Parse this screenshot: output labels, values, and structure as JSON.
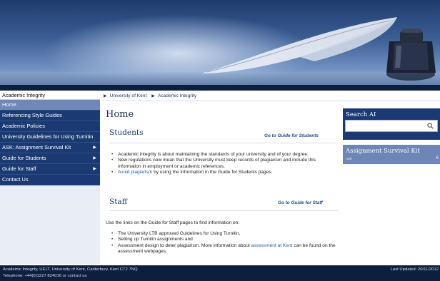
{
  "nav": {
    "title": "Academic Integrity",
    "items": [
      {
        "label": "Home",
        "arrow": ""
      },
      {
        "label": "Referencing Style Guides",
        "arrow": ""
      },
      {
        "label": "Academic Policies",
        "arrow": ""
      },
      {
        "label": "University Guidelines for Using Turnitin",
        "arrow": ""
      },
      {
        "label": "ASK: Assignment Survival Kit",
        "arrow": "▶"
      },
      {
        "label": "Guide for Students",
        "arrow": "▶"
      },
      {
        "label": "Guide for Staff",
        "arrow": "▶"
      },
      {
        "label": "Contact Us",
        "arrow": ""
      }
    ]
  },
  "breadcrumb": {
    "items": [
      "University of Kent",
      "Academic Integrity"
    ],
    "separator": "▶"
  },
  "main": {
    "title": "Home",
    "students": {
      "heading": "Students",
      "guide_link": "Go to Guide for Students",
      "bullet1": "Academic integrity is about maintaining the standards of your university and of your degree.",
      "bullet2": "New regulations now mean that the University must keep records of plagiarism and include this information in employment or academic references.",
      "bullet3_link": "Avoid plagiarism",
      "bullet3_text": " by using the information in the Guide for Students pages."
    },
    "staff": {
      "heading": "Staff",
      "guide_link": "Go to Guide for Staff",
      "intro": "Use the links on the Guide for Staff pages to find information on:",
      "bullet1": "The University LTB approved Guidelines for Using Turnitin,",
      "bullet2": "Setting up Turnitin assignments and",
      "bullet3_text": "Assessment design to deter plagiarism. More information about ",
      "bullet3_link": "assessment at Kent",
      "bullet3_tail": " can be found on the assessment webpages."
    }
  },
  "search": {
    "title": "Search AI",
    "value": "",
    "icon": "search-icon"
  },
  "survival_kit": {
    "title": "Assignment Survival Kit",
    "sub": "ASK",
    "badge": "6"
  },
  "footer": {
    "line1": "Academic Integrity, UELT, University of Kent, Canterbury, Kent CT2 7NQ",
    "line2_prefix": "Telephone: +44(0)1227 824016 or ",
    "line2_link": "contact us",
    "updated": "Last Updated: 20/11/2012"
  },
  "colors": {
    "nav_bg": "#1b3a73",
    "nav_active": "#6f88b8",
    "heading": "#1b2d52",
    "link": "#1f5fae",
    "footer_bg": "#0d1f3f"
  }
}
